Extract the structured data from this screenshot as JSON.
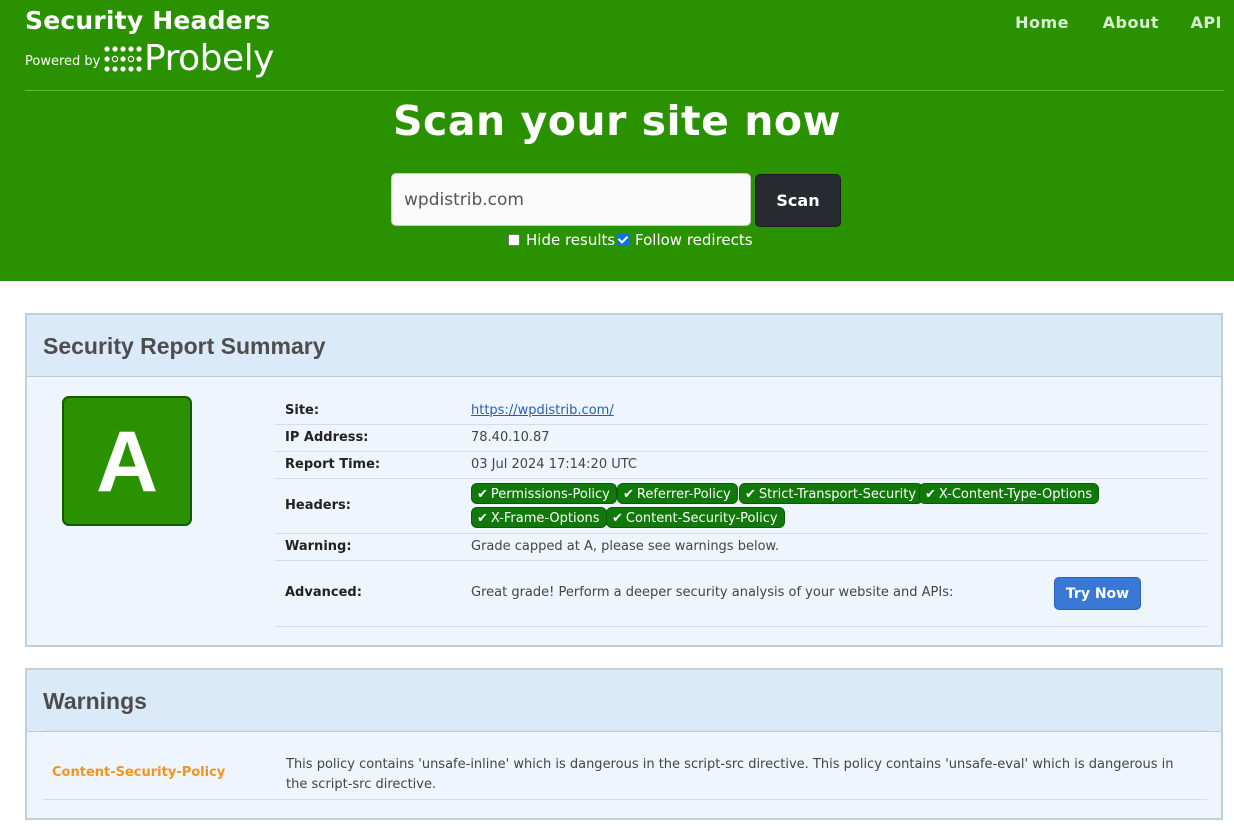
{
  "header": {
    "title": "Security Headers",
    "powered_by": "Powered by",
    "probely": "Probely",
    "nav": [
      "Home",
      "About",
      "API"
    ]
  },
  "scan": {
    "title": "Scan your site now",
    "input_value": "wpdistrib.com",
    "button": "Scan",
    "hide_results": "Hide results",
    "hide_results_checked": false,
    "follow_redirects": "Follow redirects",
    "follow_redirects_checked": true
  },
  "summary": {
    "title": "Security Report Summary",
    "grade": "A",
    "grade_color": "#2a9100",
    "rows": {
      "site_label": "Site:",
      "site_value": "https://wpdistrib.com/",
      "ip_label": "IP Address:",
      "ip_value": "78.40.10.87",
      "time_label": "Report Time:",
      "time_value": "03 Jul 2024 17:14:20 UTC",
      "headers_label": "Headers:",
      "headers": [
        "Permissions-Policy",
        "Referrer-Policy",
        "Strict-Transport-Security",
        "X-Content-Type-Options",
        "X-Frame-Options",
        "Content-Security-Policy"
      ],
      "warning_label": "Warning:",
      "warning_value": "Grade capped at A, please see warnings below.",
      "advanced_label": "Advanced:",
      "advanced_value": "Great grade! Perform a deeper security analysis of your website and APIs:",
      "try_button": "Try Now"
    }
  },
  "warnings": {
    "title": "Warnings",
    "items": [
      {
        "name": "Content-Security-Policy",
        "text": "This policy contains 'unsafe-inline' which is dangerous in the script-src directive. This policy contains 'unsafe-eval' which is dangerous in the script-src directive."
      }
    ]
  },
  "colors": {
    "header_bg": "#2a9100",
    "badge_green": "#11790a",
    "warning_orange": "#f5941a",
    "try_button_blue": "#3a78d6"
  }
}
